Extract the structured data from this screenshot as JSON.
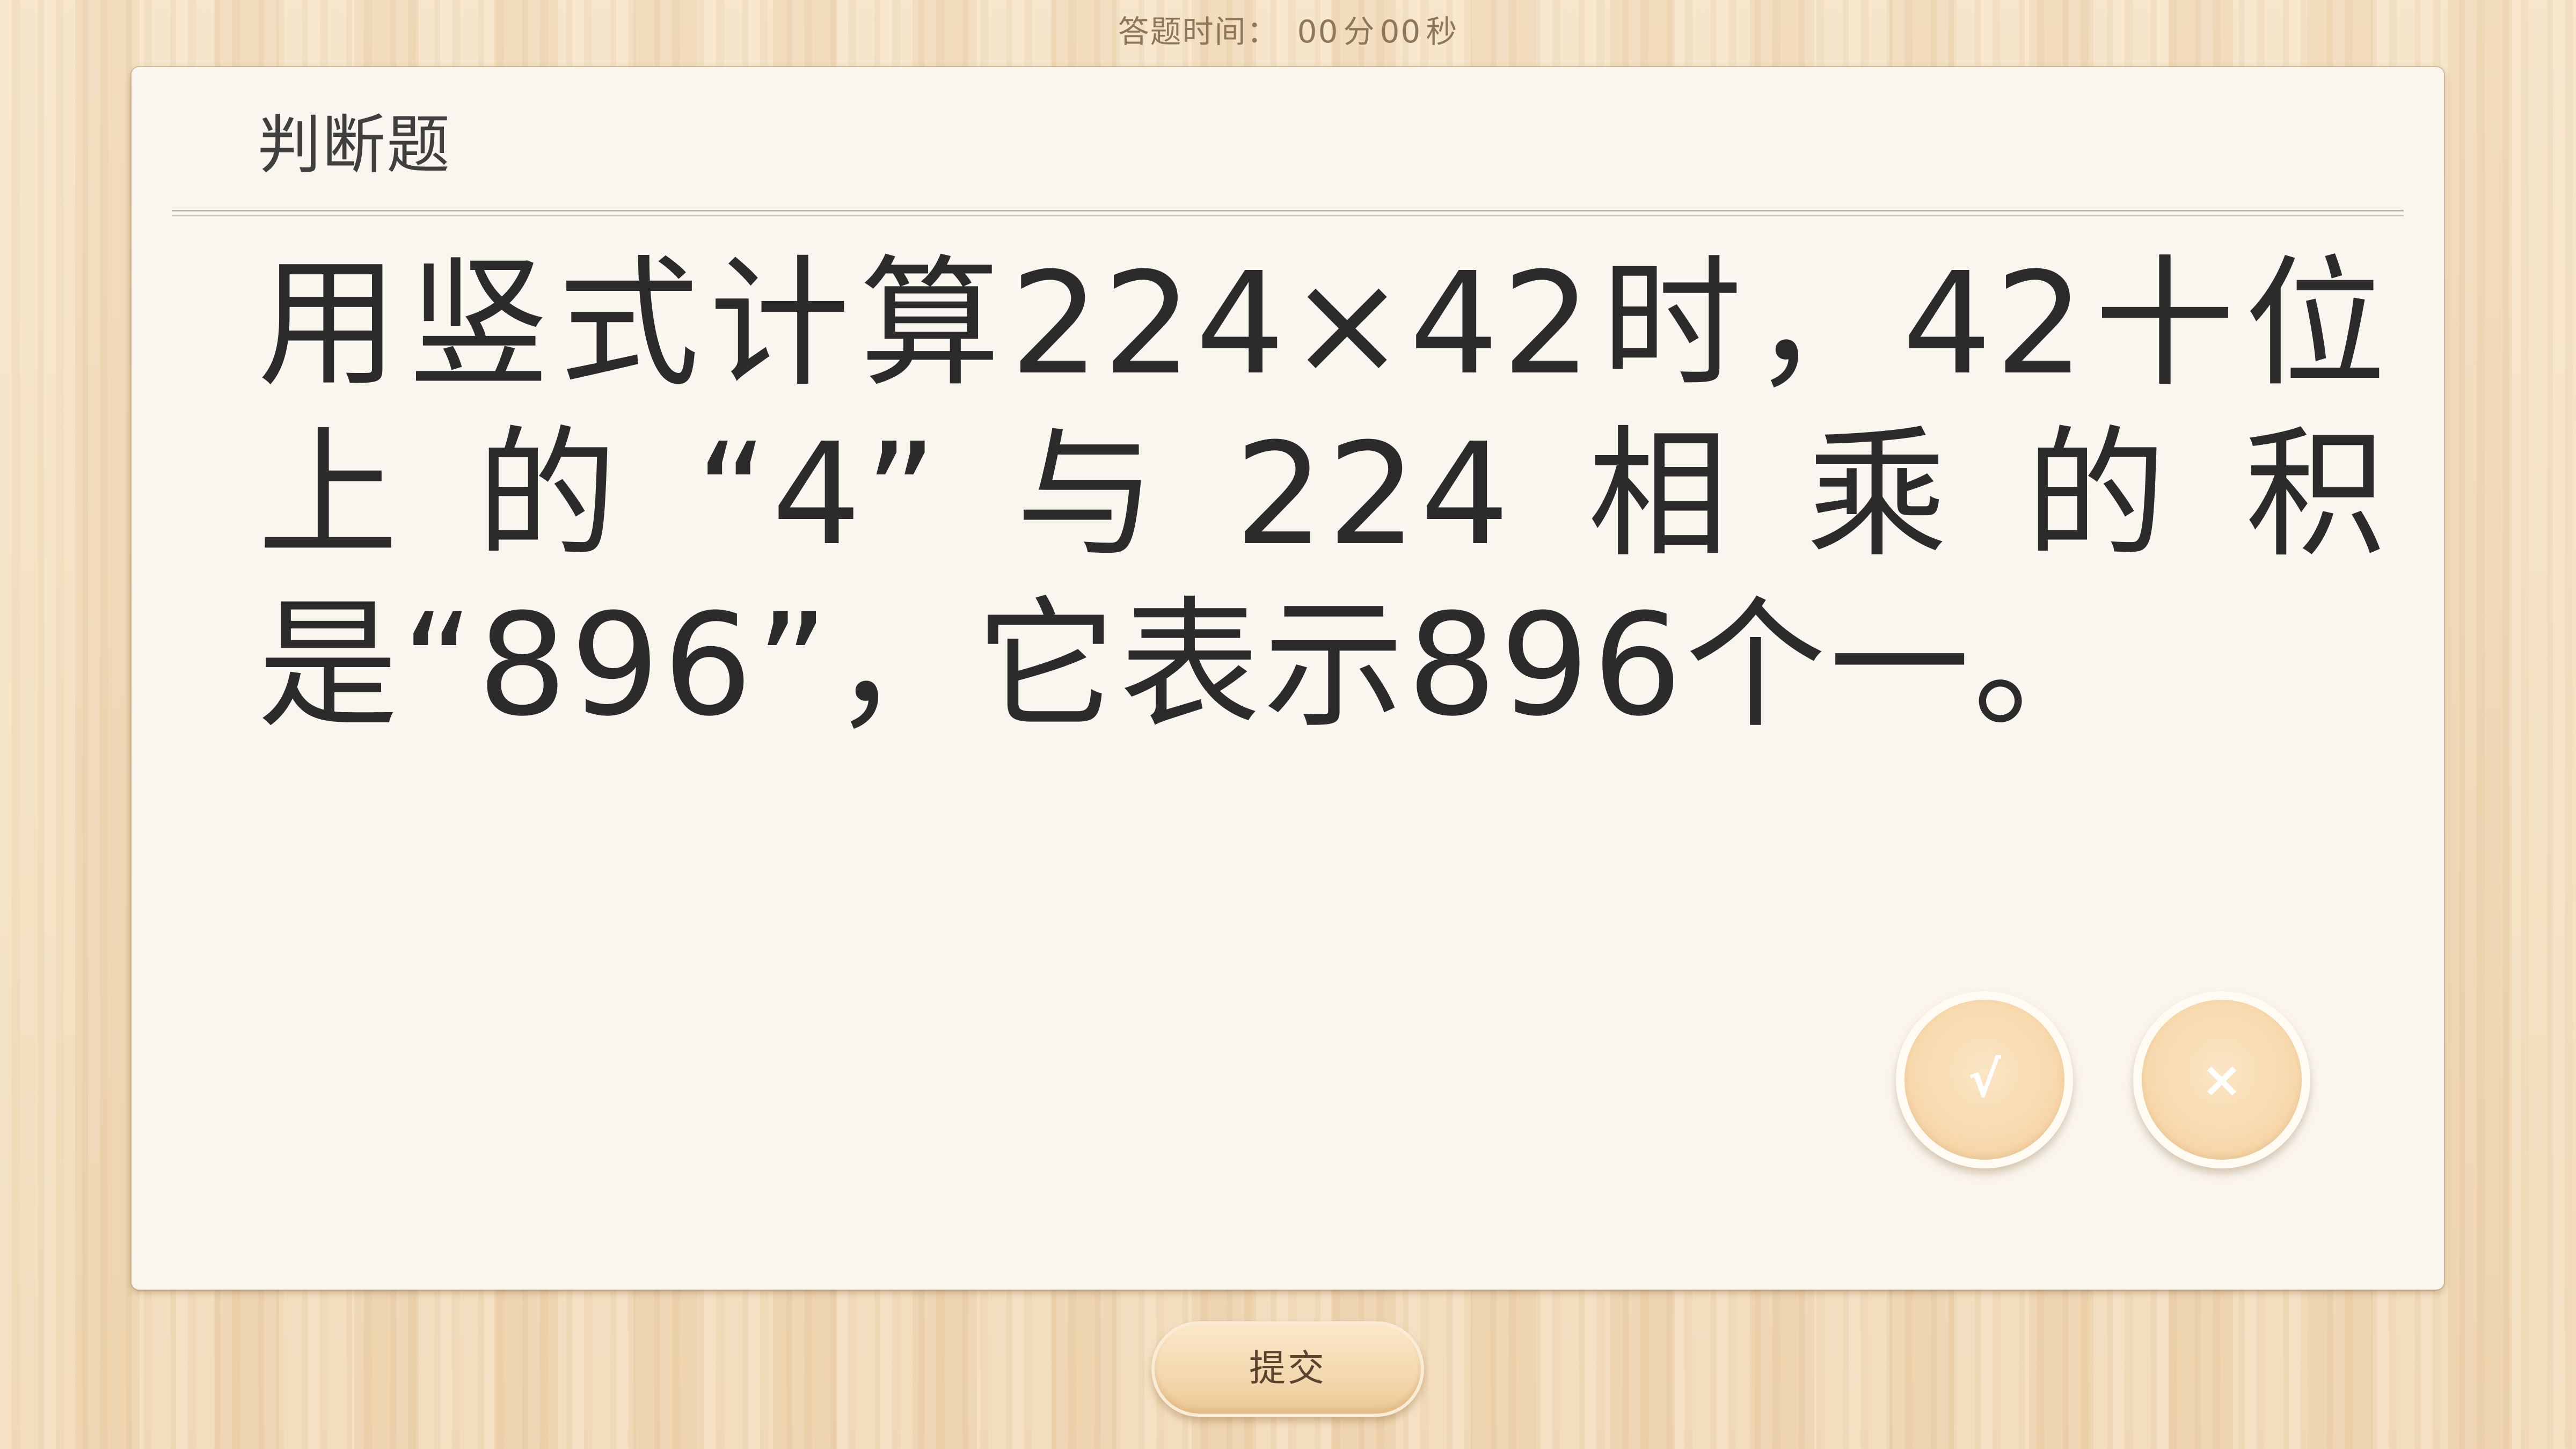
{
  "timer": {
    "label": "答题时间：",
    "minutes": "00",
    "minutes_unit": "分",
    "seconds": "00",
    "seconds_unit": "秒"
  },
  "question": {
    "type_label": "判断题",
    "text": "用竖式计算224×42时，42十位上的“4”与224相乘的积是“896”，它表示896个一。"
  },
  "options": {
    "true_symbol": "√",
    "false_symbol": "×"
  },
  "submit": {
    "label": "提交"
  },
  "colors": {
    "background_wood": "#f2dcbb",
    "card": "#faf6ef",
    "option_button": "#f7d9ad",
    "text": "#2b2b2b"
  }
}
